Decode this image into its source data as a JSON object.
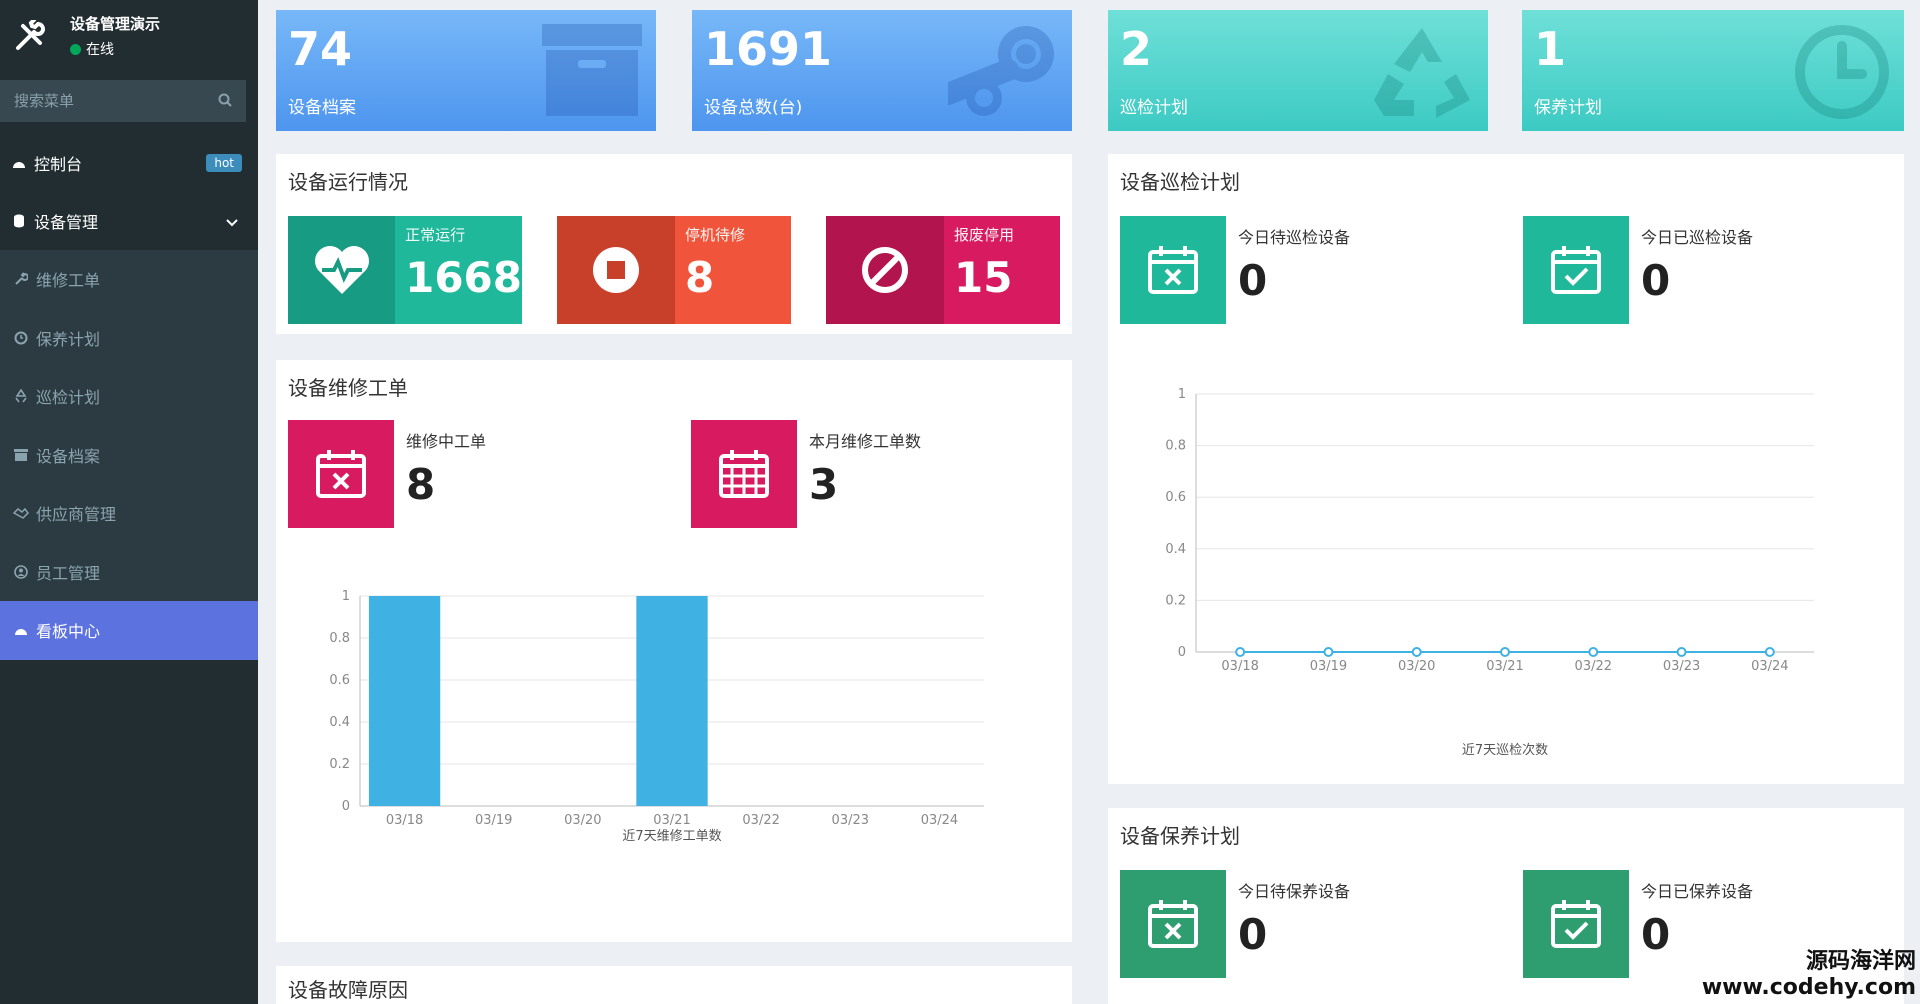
{
  "app": {
    "title": "设备管理演示",
    "status": "在线"
  },
  "search": {
    "placeholder": "搜索菜单"
  },
  "menu": {
    "dashboard": {
      "label": "控制台",
      "badge": "hot"
    },
    "device_mgmt": {
      "label": "设备管理"
    },
    "sub": [
      {
        "label": "维修工单",
        "icon": "wrench-icon"
      },
      {
        "label": "保养计划",
        "icon": "clock-icon"
      },
      {
        "label": "巡检计划",
        "icon": "recycle-icon"
      },
      {
        "label": "设备档案",
        "icon": "archive-icon"
      },
      {
        "label": "供应商管理",
        "icon": "handshake-icon"
      },
      {
        "label": "员工管理",
        "icon": "user-icon"
      },
      {
        "label": "看板中心",
        "icon": "dashboard-icon",
        "active": true
      }
    ]
  },
  "stats": [
    {
      "value": "74",
      "label": "设备档案",
      "icon": "archive-icon"
    },
    {
      "value": "1691",
      "label": "设备总数(台)",
      "icon": "steam-icon"
    },
    {
      "value": "2",
      "label": "巡检计划",
      "icon": "recycle-icon"
    },
    {
      "value": "1",
      "label": "保养计划",
      "icon": "clock-icon"
    }
  ],
  "operation": {
    "title": "设备运行情况",
    "boxes": [
      {
        "label": "正常运行",
        "value": "1668",
        "icon": "heartbeat-icon",
        "color": "#1fb89a"
      },
      {
        "label": "停机待修",
        "value": "8",
        "icon": "stop-icon",
        "color": "#f0553b"
      },
      {
        "label": "报废停用",
        "value": "15",
        "icon": "ban-icon",
        "color": "#d81b60"
      }
    ]
  },
  "repair": {
    "title": "设备维修工单",
    "tiles": [
      {
        "label": "维修中工单",
        "value": "8",
        "icon": "calendar-x-icon"
      },
      {
        "label": "本月维修工单数",
        "value": "3",
        "icon": "calendar-grid-icon"
      }
    ],
    "chart_title": "近7天维修工单数"
  },
  "inspection": {
    "title": "设备巡检计划",
    "tiles": [
      {
        "label": "今日待巡检设备",
        "value": "0",
        "icon": "calendar-x-icon"
      },
      {
        "label": "今日已巡检设备",
        "value": "0",
        "icon": "calendar-check-icon"
      }
    ],
    "chart_title": "近7天巡检次数"
  },
  "maintenance": {
    "title": "设备保养计划",
    "tiles": [
      {
        "label": "今日待保养设备",
        "value": "0",
        "icon": "calendar-x-icon"
      },
      {
        "label": "今日已保养设备",
        "value": "0",
        "icon": "calendar-check-icon"
      }
    ]
  },
  "fault": {
    "title": "设备故障原因"
  },
  "watermark": {
    "line1": "源码海洋网",
    "line2": "www.codehy.com"
  },
  "colors": {
    "sidebar": "#222d32",
    "active": "#5c72de",
    "teal_tile": "#1fb89a",
    "pink_tile": "#d81b60",
    "bar": "#3fb1e3"
  },
  "chart_data": [
    {
      "type": "bar",
      "categories": [
        "03/18",
        "03/19",
        "03/20",
        "03/21",
        "03/22",
        "03/23",
        "03/24"
      ],
      "values": [
        1,
        0,
        0,
        1,
        0,
        0,
        0
      ],
      "title": "",
      "xlabel": "近7天维修工单数",
      "ylabel": "",
      "ylim": [
        0,
        1
      ],
      "yticks": [
        "0",
        "0.2",
        "0.4",
        "0.6",
        "0.8",
        "1"
      ],
      "grid": true
    },
    {
      "type": "line",
      "categories": [
        "03/18",
        "03/19",
        "03/20",
        "03/21",
        "03/22",
        "03/23",
        "03/24"
      ],
      "values": [
        0,
        0,
        0,
        0,
        0,
        0,
        0
      ],
      "title": "",
      "xlabel": "近7天巡检次数",
      "ylabel": "",
      "ylim": [
        0,
        1
      ],
      "yticks": [
        "0",
        "0.2",
        "0.4",
        "0.6",
        "0.8",
        "1"
      ],
      "grid": true
    }
  ]
}
